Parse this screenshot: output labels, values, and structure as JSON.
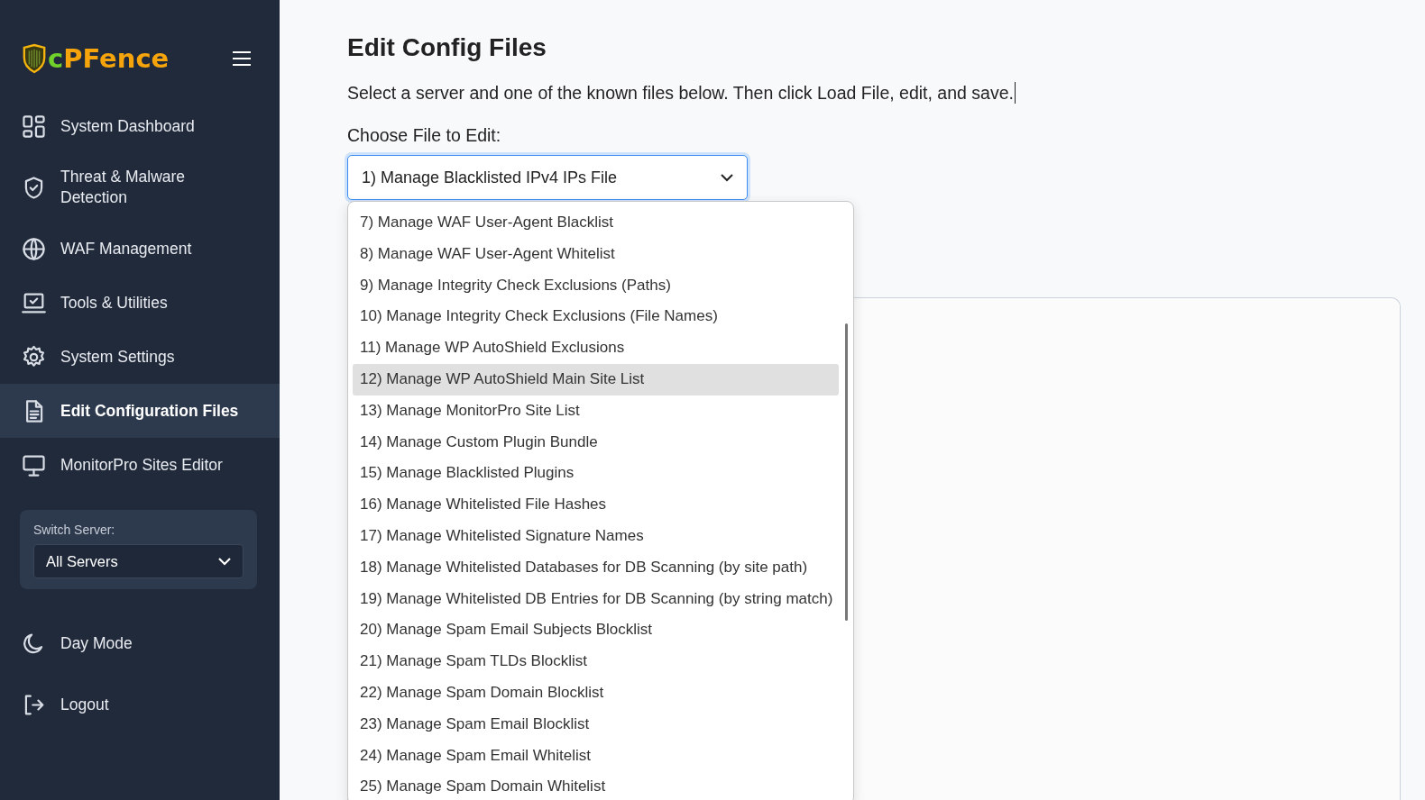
{
  "sidebar": {
    "logo": [
      {
        "text": "c",
        "color": "#6fd12a"
      },
      {
        "text": "PFence",
        "color": "#f5a40c"
      }
    ],
    "items": [
      {
        "label": "System Dashboard",
        "selected": false
      },
      {
        "label": "Threat & Malware Detection",
        "selected": false
      },
      {
        "label": "WAF Management",
        "selected": false
      },
      {
        "label": "Tools & Utilities",
        "selected": false
      },
      {
        "label": "System Settings",
        "selected": false
      },
      {
        "label": "Edit Configuration Files",
        "selected": true
      },
      {
        "label": "MonitorPro Sites Editor",
        "selected": false
      }
    ],
    "switch_server": {
      "label": "Switch Server:",
      "value": "All Servers"
    },
    "footer_items": [
      {
        "label": "Day Mode"
      },
      {
        "label": "Logout"
      }
    ]
  },
  "main": {
    "title": "Edit Config Files",
    "description": "Select a server and one of the known files below. Then click Load File, edit, and save.",
    "file_label": "Choose File to Edit:",
    "file_value": "1) Manage Blacklisted IPv4 IPs File",
    "options": [
      {
        "label": "7) Manage WAF User-Agent Blacklist",
        "selected": false
      },
      {
        "label": "8) Manage WAF User-Agent Whitelist",
        "selected": false
      },
      {
        "label": "9) Manage Integrity Check Exclusions (Paths)",
        "selected": false
      },
      {
        "label": "10) Manage Integrity Check Exclusions (File Names)",
        "selected": false
      },
      {
        "label": "11) Manage WP AutoShield Exclusions",
        "selected": false
      },
      {
        "label": "12) Manage WP AutoShield Main Site List",
        "selected": true
      },
      {
        "label": "13) Manage MonitorPro Site List",
        "selected": false
      },
      {
        "label": "14) Manage Custom Plugin Bundle",
        "selected": false
      },
      {
        "label": "15) Manage Blacklisted Plugins",
        "selected": false
      },
      {
        "label": "16) Manage Whitelisted File Hashes",
        "selected": false
      },
      {
        "label": "17) Manage Whitelisted Signature Names",
        "selected": false
      },
      {
        "label": "18) Manage Whitelisted Databases for DB Scanning (by site path)",
        "selected": false
      },
      {
        "label": "19) Manage Whitelisted DB Entries for DB Scanning (by string match)",
        "selected": false
      },
      {
        "label": "20) Manage Spam Email Subjects Blocklist",
        "selected": false
      },
      {
        "label": "21) Manage Spam TLDs Blocklist",
        "selected": false
      },
      {
        "label": "22) Manage Spam Domain Blocklist",
        "selected": false
      },
      {
        "label": "23) Manage Spam Email Blocklist",
        "selected": false
      },
      {
        "label": "24) Manage Spam Email Whitelist",
        "selected": false
      },
      {
        "label": "25) Manage Spam Domain Whitelist",
        "selected": false
      }
    ]
  }
}
